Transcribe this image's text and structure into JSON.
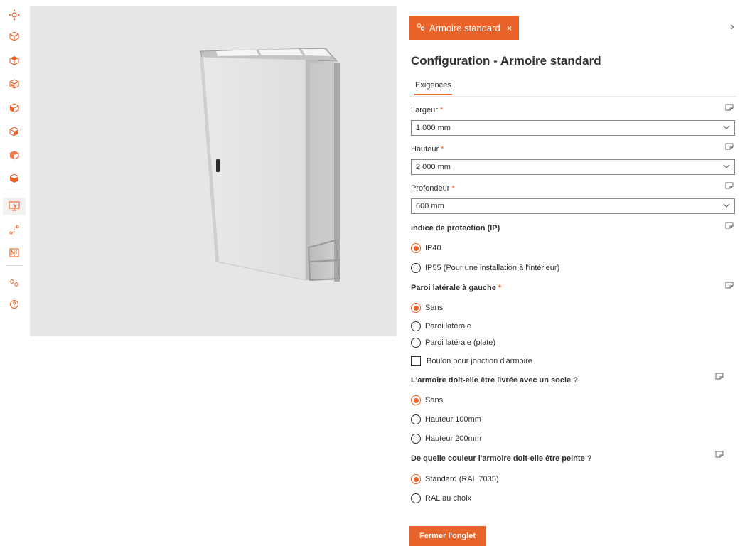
{
  "accent_color": "#e8632a",
  "rail": {
    "icons": [
      "network-icon",
      "cube-outline-icon",
      "cube-top-icon",
      "cube-front-icon",
      "cube-left-icon",
      "cube-right-icon",
      "cube-back-icon",
      "cube-bottom-icon",
      "screen-icon",
      "route-icon",
      "document-icon",
      "link-icon",
      "help-icon"
    ]
  },
  "panel": {
    "tab_label": "Armoire standard",
    "tab_close": "×",
    "collapse": "›",
    "title": "Configuration - Armoire standard",
    "subtab": "Exigences",
    "fields": {
      "largeur": {
        "label": "Largeur",
        "required": "*",
        "value": "1 000 mm"
      },
      "hauteur": {
        "label": "Hauteur",
        "required": "*",
        "value": "2 000 mm"
      },
      "profondeur": {
        "label": "Profondeur",
        "required": "*",
        "value": "600 mm"
      }
    },
    "protection": {
      "label": "indice de protection (IP)",
      "options": [
        "IP40",
        "IP55 (Pour une installation à l'intérieur)"
      ]
    },
    "paroi": {
      "label": "Paroi latérale à gauche",
      "required": "*",
      "options": [
        "Sans",
        "Paroi latérale",
        "Paroi latérale (plate)"
      ],
      "checkbox": "Boulon pour jonction d'armoire"
    },
    "socle": {
      "label": "L'armoire doit-elle être livrée avec un socle ?",
      "options": [
        "Sans",
        "Hauteur 100mm",
        "Hauteur 200mm"
      ]
    },
    "couleur": {
      "label": "De quelle couleur l'armoire doit-elle être peinte ?",
      "options": [
        "Standard (RAL 7035)",
        "RAL au choix"
      ]
    },
    "close_button": "Fermer l'onglet"
  }
}
